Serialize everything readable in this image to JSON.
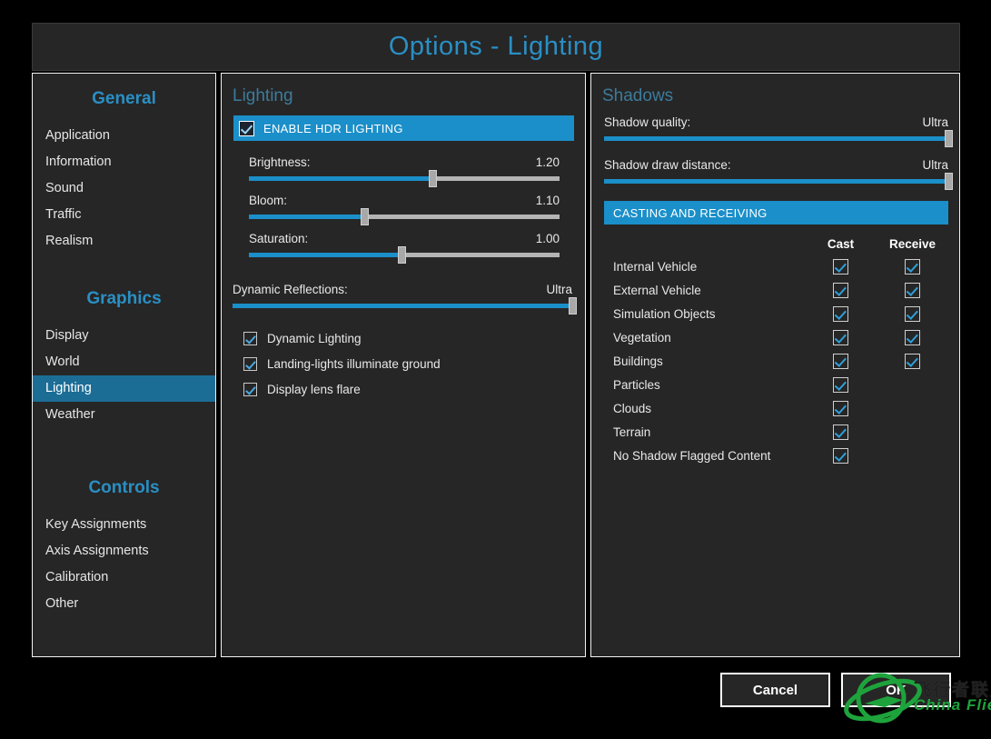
{
  "window": {
    "title": "Options - Lighting",
    "accent": "#2a8fc4",
    "highlight": "#1b8fc9",
    "panel_bg": "#262626"
  },
  "sidebar": {
    "groups": [
      {
        "title": "General",
        "items": [
          {
            "label": "Application",
            "selected": false
          },
          {
            "label": "Information",
            "selected": false
          },
          {
            "label": "Sound",
            "selected": false
          },
          {
            "label": "Traffic",
            "selected": false
          },
          {
            "label": "Realism",
            "selected": false
          }
        ]
      },
      {
        "title": "Graphics",
        "items": [
          {
            "label": "Display",
            "selected": false
          },
          {
            "label": "World",
            "selected": false
          },
          {
            "label": "Lighting",
            "selected": true
          },
          {
            "label": "Weather",
            "selected": false
          }
        ]
      },
      {
        "title": "Controls",
        "items": [
          {
            "label": "Key Assignments",
            "selected": false
          },
          {
            "label": "Axis Assignments",
            "selected": false
          },
          {
            "label": "Calibration",
            "selected": false
          },
          {
            "label": "Other",
            "selected": false
          }
        ]
      }
    ]
  },
  "lighting": {
    "heading": "Lighting",
    "hdr": {
      "label": "ENABLE HDR LIGHTING",
      "checked": true
    },
    "sliders": [
      {
        "label": "Brightness:",
        "value": "1.20",
        "percent": 59
      },
      {
        "label": "Bloom:",
        "value": "1.10",
        "percent": 37
      },
      {
        "label": "Saturation:",
        "value": "1.00",
        "percent": 49
      }
    ],
    "reflections": {
      "label": "Dynamic Reflections:",
      "value": "Ultra",
      "percent": 100
    },
    "checkboxes": [
      {
        "label": "Dynamic Lighting",
        "checked": true
      },
      {
        "label": "Landing-lights illuminate ground",
        "checked": true
      },
      {
        "label": "Display lens flare",
        "checked": true
      }
    ]
  },
  "shadows": {
    "heading": "Shadows",
    "sliders": [
      {
        "label": "Shadow quality:",
        "value": "Ultra",
        "percent": 100
      },
      {
        "label": "Shadow draw distance:",
        "value": "Ultra",
        "percent": 100
      }
    ],
    "casting_bar": "CASTING AND RECEIVING",
    "columns": {
      "cast": "Cast",
      "receive": "Receive"
    },
    "rows": [
      {
        "label": "Internal Vehicle",
        "cast": true,
        "receive": true
      },
      {
        "label": "External Vehicle",
        "cast": true,
        "receive": true
      },
      {
        "label": "Simulation Objects",
        "cast": true,
        "receive": true
      },
      {
        "label": "Vegetation",
        "cast": true,
        "receive": true
      },
      {
        "label": "Buildings",
        "cast": true,
        "receive": true
      },
      {
        "label": "Particles",
        "cast": true,
        "receive": null
      },
      {
        "label": "Clouds",
        "cast": true,
        "receive": null
      },
      {
        "label": "Terrain",
        "cast": true,
        "receive": null
      },
      {
        "label": "No Shadow Flagged Content",
        "cast": true,
        "receive": null
      }
    ]
  },
  "footer": {
    "cancel_label": "Cancel",
    "ok_label": "OK"
  },
  "watermark": {
    "chinese": "飞行者联盟",
    "english": "China Flier",
    "color": "#1ea33c"
  }
}
